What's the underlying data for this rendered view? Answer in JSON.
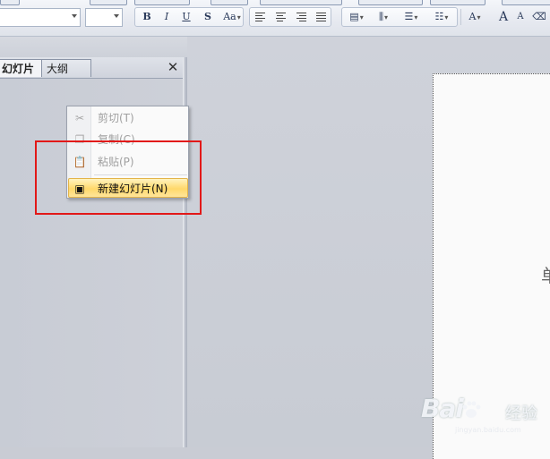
{
  "ribbon": {
    "font_format_buttons": [
      "B",
      "I",
      "U",
      "S",
      "Aa"
    ],
    "misc_glyphs": [
      "A",
      "A",
      "A"
    ]
  },
  "pane": {
    "tabs": [
      {
        "label": "幻灯片",
        "active": true
      },
      {
        "label": "大纲",
        "active": false
      }
    ],
    "close_glyph": "✕"
  },
  "context_menu": {
    "items": [
      {
        "icon": "scissors-icon",
        "glyph": "✂",
        "label": "剪切(T)",
        "enabled": false
      },
      {
        "icon": "copy-icon",
        "glyph": "❐",
        "label": "复制(C)",
        "enabled": false
      },
      {
        "icon": "paste-icon",
        "glyph": "📋",
        "label": "粘贴(P)",
        "enabled": false
      },
      {
        "icon": "new-slide-icon",
        "glyph": "▣",
        "label": "新建幻灯片(N)",
        "enabled": true,
        "highlighted": true
      }
    ]
  },
  "slide": {
    "partial_text": "单"
  },
  "watermark": {
    "logo_text": "Bai",
    "brand_text": "经验",
    "url": "jingyan.baidu.com"
  },
  "colors": {
    "highlight_border": "#e21818",
    "menu_hover": "#ffd86a",
    "pane_bg": "#c9ccd5"
  }
}
